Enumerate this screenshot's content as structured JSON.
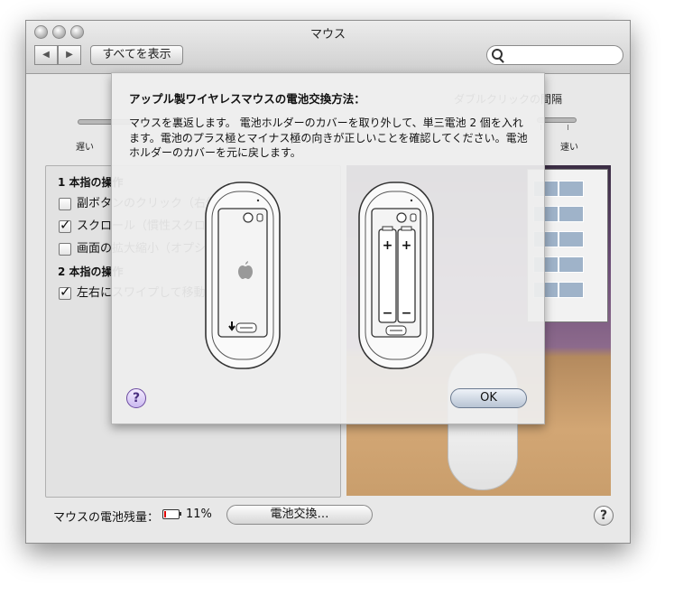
{
  "window": {
    "title": "マウス"
  },
  "toolbar": {
    "show_all_label": "すべてを表示",
    "back_icon": "◀",
    "forward_icon": "▶"
  },
  "search": {
    "placeholder": "",
    "icon": "search-icon"
  },
  "background": {
    "double_click_label": "ダブルクリックの間隔",
    "slow_label": "遅い",
    "fast_label": "速い",
    "one_finger_heading": "1 本指の操作",
    "one_finger_options": [
      {
        "label": "副ボタンのクリック（右側）",
        "checked": false
      },
      {
        "label": "スクロール（慣性スクロールを使用）",
        "checked": true
      },
      {
        "label": "画面の拡大縮小（オプション）",
        "checked": false
      }
    ],
    "two_finger_heading": "2 本指の操作",
    "two_finger_options": [
      {
        "label": "左右にスワイプして移動",
        "checked": true
      }
    ]
  },
  "battery": {
    "label": "マウスの電池残量：",
    "percent_text": "11%",
    "level": 0.11,
    "replace_button": "電池交換…"
  },
  "help": {
    "glyph": "?"
  },
  "sheet": {
    "title": "アップル製ワイヤレスマウスの電池交換方法：",
    "body": "マウスを裏返します。 電池ホルダーのカバーを取り外して、単三電池 2 個を入れます。電池のプラス極とマイナス極の向きが正しいことを確認してください。電池ホルダーのカバーを元に戻します。",
    "ok_button": "OK",
    "plus": "+",
    "minus": "−"
  },
  "colors": {
    "battery_low": "#dd0000",
    "help_accent": "#6b4aa0"
  }
}
